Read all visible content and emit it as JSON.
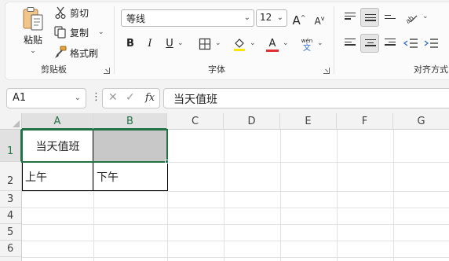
{
  "ribbon": {
    "clipboard": {
      "paste_label": "粘贴",
      "cut_label": "剪切",
      "copy_label": "复制",
      "format_painter_label": "格式刷",
      "group_label": "剪贴板"
    },
    "font": {
      "font_name": "等线",
      "font_size": "12",
      "grow_font": "A",
      "shrink_font": "A",
      "bold": "B",
      "italic": "I",
      "underline": "U",
      "font_color_letter": "A",
      "phonetic_top": "wén",
      "phonetic_bottom": "文",
      "group_label": "字体",
      "highlight_color": "#ffe600",
      "font_color": "#e03030"
    },
    "alignment": {
      "group_label": "对齐方式"
    }
  },
  "formula_bar": {
    "name_box": "A1",
    "formula": "当天值班"
  },
  "sheet": {
    "columns": [
      "A",
      "B",
      "C",
      "D",
      "E",
      "F",
      "G"
    ],
    "rows": [
      "1",
      "2",
      "3",
      "4",
      "5",
      "6"
    ],
    "cells": {
      "A1": "当天值班",
      "B1": "",
      "A2": "上午",
      "B2": "下午"
    },
    "b1_fill": "#c8c8c8",
    "accent": "#217346"
  }
}
